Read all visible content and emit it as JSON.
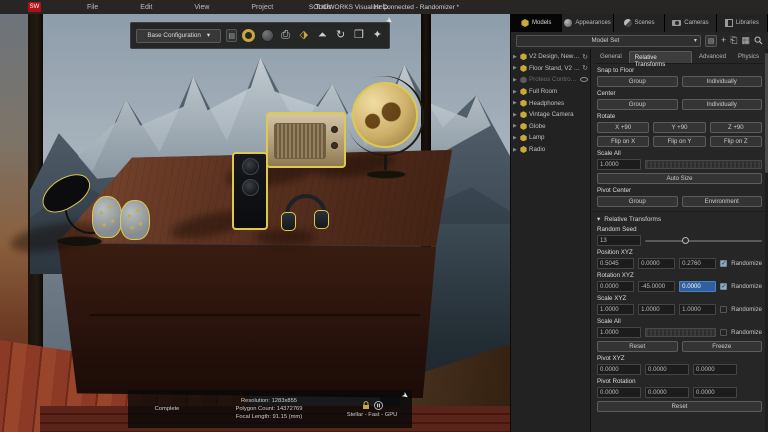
{
  "titlebar": {
    "logo": "SW",
    "menus": [
      "File",
      "Edit",
      "View",
      "Project",
      "Tools",
      "Help"
    ],
    "title": "SOLIDWORKS Visualize Connected - Randomizer *"
  },
  "toolbar": {
    "config": "Base Configuration",
    "caret": "▾",
    "icons": [
      "render-icon",
      "appearances-sphere-icon",
      "output-tools-icon",
      "export-icon",
      "scene-tree-icon",
      "turntable-icon",
      "pack-project-icon",
      "fast-mode-icon"
    ]
  },
  "panel": {
    "tabs": [
      {
        "label": "Models"
      },
      {
        "label": "Appearances"
      },
      {
        "label": "Scenes"
      },
      {
        "label": "Cameras"
      },
      {
        "label": "Libraries"
      }
    ],
    "model_set": "Model Set",
    "tree": [
      {
        "label": "V2 Design, New (D..."
      },
      {
        "label": "Floor Stand, V2 (D..."
      },
      {
        "label": "Proteus Controller"
      },
      {
        "label": "Full Room"
      },
      {
        "label": "Headphones"
      },
      {
        "label": "Vintage Camera"
      },
      {
        "label": "Globe"
      },
      {
        "label": "Lamp"
      },
      {
        "label": "Radio"
      }
    ],
    "prop_tabs": [
      "General",
      "Relative Transforms",
      "Advanced",
      "Physics"
    ],
    "sections": {
      "snap_to_floor": "Snap to Floor",
      "center": "Center",
      "rotate": "Rotate",
      "scale_all": "Scale All",
      "pivot_center": "Pivot Center"
    },
    "buttons": {
      "group": "Group",
      "individually": "Individually",
      "x90": "X +90",
      "y90": "Y +90",
      "z90": "Z +90",
      "flipx": "Flip on X",
      "flipy": "Flip on Y",
      "flipz": "Flip on Z",
      "auto_size": "Auto Size",
      "environment": "Environment",
      "reset": "Reset",
      "freeze": "Freeze"
    },
    "scale_all_value": "1.0000",
    "rt": {
      "header": "Relative Transforms",
      "random_seed_label": "Random Seed",
      "random_seed": "13",
      "position_label": "Position XYZ",
      "position": [
        "0.5045",
        "0.0000",
        "0.2760"
      ],
      "rotation_label": "Rotation XYZ",
      "rotation": [
        "0.0000",
        "-45.0000",
        "0.0000"
      ],
      "scale_label": "Scale XYZ",
      "scale": [
        "1.0000",
        "1.0000",
        "1.0000"
      ],
      "scale_all_label": "Scale All",
      "scale_all": "1.0000",
      "randomize": "Randomize",
      "check_glyph": "✓",
      "pivot_label": "Pivot XYZ",
      "pivot": [
        "0.0000",
        "0.0000",
        "0.0000"
      ],
      "pivot_rot_label": "Pivot Rotation",
      "pivot_rot": [
        "0.0000",
        "0.0000",
        "0.0000"
      ]
    }
  },
  "status": {
    "complete": "Complete",
    "resolution": "Resolution: 1283x855",
    "polygons": "Polygon Count: 14372769",
    "focal": "Focal Length: 91.15 (mm)",
    "engine": "Stellar - Fast - GPU"
  },
  "colors": {
    "accent_yellow": "#c9a93a",
    "selection_outline": "#dcc94e",
    "selected_field_blue": "#2f5f9e",
    "panel_bg": "#262626"
  }
}
